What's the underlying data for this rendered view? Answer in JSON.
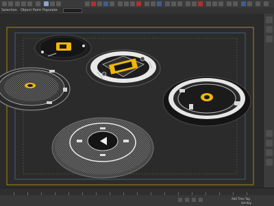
{
  "menubar": {
    "items": [
      "Selection",
      "Object Paint",
      "Populate"
    ]
  },
  "viewport": {
    "label": "Perspective viewport with five circular UI dial models"
  },
  "statusbar": {
    "right_text_1": "Add Time Tag",
    "right_text_2": "Set Key"
  },
  "colors": {
    "accent_yellow": "#f2b705",
    "panel_dark": "#1c1c1c",
    "viewport_frame_yellow": "#c8a400",
    "viewport_frame_blue": "#5a7fb0"
  }
}
